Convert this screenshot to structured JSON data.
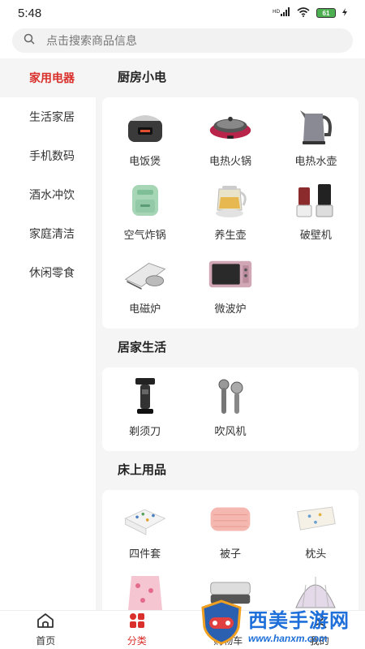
{
  "status": {
    "time": "5:48",
    "signal": "HD",
    "battery": "61"
  },
  "search": {
    "placeholder": "点击搜索商品信息"
  },
  "sidebar": {
    "items": [
      {
        "label": "家用电器",
        "active": true
      },
      {
        "label": "生活家居",
        "active": false
      },
      {
        "label": "手机数码",
        "active": false
      },
      {
        "label": "酒水冲饮",
        "active": false
      },
      {
        "label": "家庭清洁",
        "active": false
      },
      {
        "label": "休闲零食",
        "active": false
      }
    ]
  },
  "sections": [
    {
      "title": "厨房小电",
      "items": [
        {
          "label": "电饭煲",
          "icon": "rice-cooker-icon"
        },
        {
          "label": "电热火锅",
          "icon": "hot-pot-icon"
        },
        {
          "label": "电热水壶",
          "icon": "kettle-icon"
        },
        {
          "label": "空气炸锅",
          "icon": "air-fryer-icon"
        },
        {
          "label": "养生壶",
          "icon": "health-pot-icon"
        },
        {
          "label": "破壁机",
          "icon": "blender-icon"
        },
        {
          "label": "电磁炉",
          "icon": "induction-cooker-icon"
        },
        {
          "label": "微波炉",
          "icon": "microwave-icon"
        }
      ]
    },
    {
      "title": "居家生活",
      "items": [
        {
          "label": "剃须刀",
          "icon": "razor-icon"
        },
        {
          "label": "吹风机",
          "icon": "hair-dryer-icon"
        }
      ]
    },
    {
      "title": "床上用品",
      "items": [
        {
          "label": "四件套",
          "icon": "bedding-set-icon"
        },
        {
          "label": "被子",
          "icon": "quilt-icon"
        },
        {
          "label": "枕头",
          "icon": "pillow-icon"
        },
        {
          "label": "",
          "icon": "blanket-icon"
        },
        {
          "label": "",
          "icon": "mattress-icon"
        },
        {
          "label": "",
          "icon": "mosquito-net-icon"
        }
      ]
    }
  ],
  "tabbar": {
    "tabs": [
      {
        "label": "首页",
        "icon": "home-icon",
        "active": false
      },
      {
        "label": "分类",
        "icon": "category-icon",
        "active": true
      },
      {
        "label": "购物车",
        "icon": "cart-icon",
        "active": false
      },
      {
        "label": "我的",
        "icon": "user-icon",
        "active": false
      }
    ]
  },
  "watermark": {
    "title": "西美手游网",
    "url": "www.hanxm.com"
  },
  "colors": {
    "accent": "#d9302b",
    "background": "#f5f5f5",
    "watermark": "#1e6fd9"
  }
}
